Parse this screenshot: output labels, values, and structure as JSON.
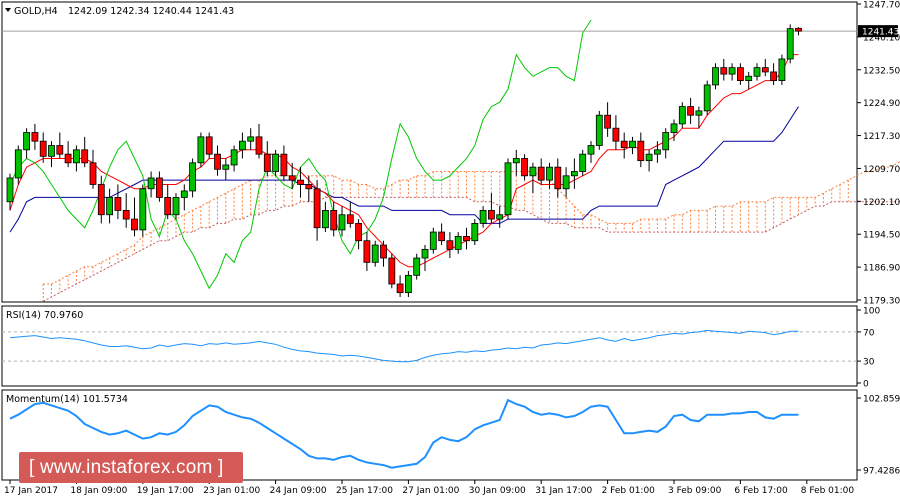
{
  "main_header": {
    "symbol": "GOLD,H4",
    "ohlc": "1242.09 1242.34 1240.44 1241.43"
  },
  "rsi_header": "RSI(14) 70.9760",
  "momentum_header": "Momentum(14) 101.5734",
  "watermark": "[ www.instaforex.com ]",
  "colors": {
    "bull": "#00c000",
    "bear": "#ff0000",
    "tenkan": "#ff0000",
    "kijun": "#0000a0",
    "chikou": "#00c800",
    "cloud": "#ff8040",
    "cloud_b": "#c06060",
    "indicator": "#1e90ff",
    "banner": "#d35a56"
  },
  "chart_data": [
    {
      "type": "candlestick",
      "price_axis": {
        "ticks": [
          "1247.70",
          "1240.10",
          "1232.50",
          "1224.90",
          "1217.30",
          "1209.70",
          "1202.10",
          "1194.50",
          "1186.90",
          "1179.30"
        ],
        "range": [
          1179.3,
          1247.7
        ],
        "current_price_label": "1241.43",
        "current_price": 1241.43
      },
      "time_axis": {
        "labels": [
          "17 Jan 2017",
          "18 Jan 09:00",
          "19 Jan 17:00",
          "23 Jan 01:00",
          "24 Jan 09:00",
          "25 Jan 17:00",
          "27 Jan 01:00",
          "30 Jan 09:00",
          "31 Jan 17:00",
          "2 Feb 01:00",
          "3 Feb 09:00",
          "6 Feb 17:00",
          "8 Feb 01:00"
        ],
        "label_bar_index": [
          0,
          8,
          16,
          24,
          32,
          40,
          48,
          56,
          64,
          72,
          80,
          88,
          96
        ]
      },
      "candles": [
        [
          1202,
          1208.5,
          1200,
          1207.5
        ],
        [
          1207.5,
          1215,
          1206,
          1214
        ],
        [
          1214,
          1219,
          1212,
          1218
        ],
        [
          1218,
          1220,
          1214,
          1216
        ],
        [
          1216,
          1218,
          1211,
          1212.5
        ],
        [
          1212.5,
          1216,
          1210,
          1215
        ],
        [
          1215,
          1218,
          1212,
          1213
        ],
        [
          1213,
          1216,
          1210,
          1211
        ],
        [
          1211,
          1215,
          1209,
          1214
        ],
        [
          1214,
          1217,
          1210,
          1211
        ],
        [
          1211,
          1214,
          1205,
          1206
        ],
        [
          1206,
          1208,
          1197,
          1199
        ],
        [
          1199,
          1205,
          1197,
          1203
        ],
        [
          1203,
          1206,
          1198,
          1200
        ],
        [
          1200,
          1204,
          1196,
          1198
        ],
        [
          1198,
          1203,
          1194,
          1195.5
        ],
        [
          1195.5,
          1206,
          1194,
          1205
        ],
        [
          1205,
          1209,
          1203,
          1207.5
        ],
        [
          1207.5,
          1209,
          1202,
          1203
        ],
        [
          1203,
          1206,
          1198,
          1199
        ],
        [
          1199,
          1204,
          1198,
          1203
        ],
        [
          1203,
          1206,
          1200,
          1204.5
        ],
        [
          1204.5,
          1212,
          1203,
          1211
        ],
        [
          1211,
          1218,
          1210,
          1217
        ],
        [
          1217,
          1218,
          1212,
          1213
        ],
        [
          1213,
          1215,
          1208,
          1209.5
        ],
        [
          1209.5,
          1212,
          1207,
          1210.5
        ],
        [
          1210.5,
          1215,
          1209,
          1214
        ],
        [
          1214,
          1218,
          1212,
          1216
        ],
        [
          1216,
          1219,
          1214,
          1217
        ],
        [
          1217,
          1220,
          1212,
          1213
        ],
        [
          1213,
          1216,
          1208,
          1209
        ],
        [
          1209,
          1214,
          1208,
          1213
        ],
        [
          1213,
          1215,
          1207,
          1208
        ],
        [
          1208,
          1211,
          1205,
          1207
        ],
        [
          1207,
          1210,
          1203,
          1206
        ],
        [
          1206,
          1208,
          1202,
          1205
        ],
        [
          1205,
          1207,
          1193,
          1196
        ],
        [
          1196,
          1202,
          1195,
          1200
        ],
        [
          1200,
          1202,
          1194,
          1195.5
        ],
        [
          1195.5,
          1201,
          1194,
          1199
        ],
        [
          1199,
          1202,
          1196,
          1197
        ],
        [
          1197,
          1198,
          1191,
          1193
        ],
        [
          1193,
          1195,
          1186,
          1188
        ],
        [
          1188,
          1193,
          1187,
          1192
        ],
        [
          1192,
          1193,
          1187,
          1189
        ],
        [
          1189,
          1190,
          1182,
          1183
        ],
        [
          1183,
          1185,
          1180,
          1181
        ],
        [
          1181,
          1186,
          1180,
          1185
        ],
        [
          1185,
          1190,
          1184,
          1189
        ],
        [
          1189,
          1192,
          1186,
          1191
        ],
        [
          1191,
          1196,
          1190,
          1195
        ],
        [
          1195,
          1197,
          1192,
          1193
        ],
        [
          1193,
          1195,
          1189,
          1191
        ],
        [
          1191,
          1195,
          1190,
          1194
        ],
        [
          1194,
          1196,
          1191,
          1193
        ],
        [
          1193,
          1198,
          1192,
          1197
        ],
        [
          1197,
          1201,
          1196,
          1200
        ],
        [
          1200,
          1204,
          1197,
          1198
        ],
        [
          1198,
          1201,
          1196,
          1199
        ],
        [
          1199,
          1212,
          1198,
          1211
        ],
        [
          1211,
          1214,
          1208,
          1212
        ],
        [
          1212,
          1213,
          1207,
          1208
        ],
        [
          1208,
          1211,
          1204,
          1210
        ],
        [
          1210,
          1212,
          1206,
          1207
        ],
        [
          1207,
          1211,
          1205,
          1210
        ],
        [
          1210,
          1212,
          1203,
          1205
        ],
        [
          1205,
          1210,
          1203,
          1208
        ],
        [
          1208,
          1212,
          1205,
          1209
        ],
        [
          1209,
          1214,
          1208,
          1213
        ],
        [
          1213,
          1216,
          1211,
          1215
        ],
        [
          1215,
          1223,
          1214,
          1222
        ],
        [
          1222,
          1225,
          1217,
          1219
        ],
        [
          1219,
          1222,
          1214,
          1216
        ],
        [
          1216,
          1218,
          1212,
          1214.5
        ],
        [
          1214.5,
          1217,
          1213,
          1216
        ],
        [
          1216,
          1218,
          1210,
          1211.5
        ],
        [
          1211.5,
          1214,
          1209,
          1213
        ],
        [
          1213,
          1216,
          1211,
          1214
        ],
        [
          1214,
          1219,
          1212,
          1218
        ],
        [
          1218,
          1221,
          1216,
          1220
        ],
        [
          1220,
          1225,
          1219,
          1224
        ],
        [
          1224,
          1226,
          1220,
          1222
        ],
        [
          1222,
          1224,
          1219,
          1223
        ],
        [
          1223,
          1230,
          1222,
          1229
        ],
        [
          1229,
          1234,
          1228,
          1233
        ],
        [
          1233,
          1235,
          1230,
          1231.5
        ],
        [
          1231.5,
          1234,
          1230,
          1233
        ],
        [
          1233,
          1234,
          1229,
          1230
        ],
        [
          1230,
          1232,
          1228,
          1231
        ],
        [
          1231,
          1234,
          1230,
          1233
        ],
        [
          1233,
          1235,
          1231,
          1232
        ],
        [
          1232,
          1234,
          1229,
          1230
        ],
        [
          1230,
          1236,
          1229,
          1235
        ],
        [
          1235,
          1243,
          1234,
          1242
        ],
        [
          1242.09,
          1242.34,
          1240.44,
          1241.43
        ]
      ],
      "tenkan": [
        1200,
        1206,
        1210,
        1211,
        1212,
        1212,
        1212,
        1212,
        1212,
        1212,
        1211,
        1209,
        1208,
        1207,
        1206,
        1205,
        1205,
        1206,
        1206,
        1206,
        1206,
        1207,
        1209,
        1210,
        1212,
        1212,
        1212,
        1213,
        1214,
        1214,
        1214,
        1213,
        1213,
        1212,
        1210,
        1209,
        1207,
        1205,
        1204,
        1202,
        1201,
        1200,
        1199,
        1196,
        1194,
        1192,
        1190,
        1188,
        1187,
        1187,
        1188,
        1189,
        1190,
        1191,
        1192,
        1193,
        1194,
        1195,
        1197,
        1198,
        1199,
        1205,
        1206,
        1207,
        1206,
        1206,
        1206,
        1206,
        1207,
        1208,
        1209,
        1212,
        1214,
        1214,
        1214,
        1215,
        1214,
        1214,
        1215,
        1216,
        1217,
        1219,
        1219,
        1219,
        1222,
        1224,
        1226,
        1227,
        1227,
        1228,
        1229,
        1230,
        1230,
        1232,
        1236,
        1236
      ],
      "kijun": [
        1195,
        1198,
        1202,
        1203,
        1203,
        1203,
        1203,
        1203,
        1203,
        1203,
        1203,
        1203,
        1203,
        1204,
        1205,
        1206,
        1207,
        1207,
        1207,
        1207,
        1207,
        1207,
        1207,
        1207,
        1207,
        1207,
        1207,
        1207,
        1207,
        1207,
        1207,
        1207,
        1207,
        1207,
        1207,
        1206,
        1206,
        1205,
        1204,
        1203,
        1203,
        1202,
        1201,
        1201,
        1201,
        1201,
        1200,
        1200,
        1200,
        1200,
        1200,
        1200,
        1200,
        1199,
        1199,
        1199,
        1199,
        1197,
        1197,
        1197,
        1198,
        1198,
        1198,
        1198,
        1198,
        1198,
        1198,
        1198,
        1198,
        1198,
        1200,
        1201,
        1201,
        1201,
        1201,
        1201,
        1201,
        1201,
        1201,
        1206,
        1207,
        1208,
        1209,
        1210,
        1212,
        1214,
        1216,
        1216,
        1216,
        1216,
        1216,
        1216,
        1216,
        1218,
        1221,
        1224
      ],
      "chikou": [
        1206,
        1210,
        1212,
        1211,
        1209,
        1206,
        1203,
        1200,
        1198,
        1196,
        1200,
        1205,
        1210,
        1214,
        1216,
        1212,
        1208,
        1198,
        1194,
        1200,
        1198,
        1193,
        1190,
        1186,
        1182,
        1185,
        1190,
        1188,
        1193,
        1195,
        1205,
        1210,
        1208,
        1206,
        1205,
        1210,
        1212,
        1209,
        1207,
        1199,
        1193,
        1190,
        1194,
        1195,
        1198,
        1203,
        1212,
        1220,
        1217,
        1212,
        1209,
        1207,
        1207,
        1208,
        1210,
        1212,
        1215,
        1221,
        1224,
        1225,
        1228,
        1236,
        1233,
        1231,
        1232,
        1233,
        1233,
        1231,
        1230,
        1241,
        1244
      ],
      "span_a": [
        1183,
        1183,
        1184,
        1185,
        1186,
        1187,
        1187,
        1188,
        1189,
        1190,
        1191,
        1192,
        1194,
        1195,
        1196,
        1197,
        1198,
        1199,
        1200,
        1201,
        1202,
        1203,
        1204,
        1205,
        1206,
        1207,
        1207,
        1208,
        1208,
        1208,
        1208,
        1208,
        1208,
        1208,
        1208,
        1208,
        1207,
        1207,
        1206,
        1206,
        1205,
        1205,
        1206,
        1207,
        1207,
        1208,
        1208,
        1209,
        1209,
        1209,
        1209,
        1209,
        1209,
        1209,
        1209,
        1209,
        1209,
        1209,
        1209,
        1209,
        1208,
        1207,
        1205,
        1203,
        1201,
        1199,
        1199,
        1198,
        1197,
        1197,
        1197,
        1197,
        1198,
        1198,
        1198,
        1198,
        1199,
        1199,
        1200,
        1200,
        1200,
        1201,
        1201,
        1201,
        1202,
        1202,
        1202,
        1202,
        1203,
        1203,
        1203,
        1203,
        1203,
        1203,
        1204,
        1205,
        1206,
        1207,
        1208,
        1209,
        1209,
        1210,
        1210,
        1211,
        1212
      ],
      "span_b": [
        1179,
        1180,
        1181,
        1182,
        1183,
        1184,
        1185,
        1186,
        1187,
        1188,
        1189,
        1190,
        1191,
        1192,
        1193,
        1193,
        1194,
        1195,
        1195,
        1196,
        1196,
        1197,
        1197,
        1198,
        1198,
        1199,
        1199,
        1200,
        1200,
        1201,
        1201,
        1202,
        1202,
        1202,
        1203,
        1203,
        1203,
        1203,
        1203,
        1203,
        1203,
        1203,
        1203,
        1203,
        1203,
        1203,
        1203,
        1203,
        1203,
        1203,
        1203,
        1203,
        1202,
        1202,
        1202,
        1201,
        1201,
        1200,
        1200,
        1199,
        1198,
        1197,
        1197,
        1197,
        1196,
        1196,
        1196,
        1196,
        1195,
        1195,
        1195,
        1195,
        1195,
        1195,
        1195,
        1195,
        1195,
        1195,
        1195,
        1195,
        1195,
        1195,
        1195,
        1195,
        1195,
        1195,
        1195,
        1195,
        1196,
        1197,
        1198,
        1199,
        1200,
        1201,
        1201,
        1202,
        1202,
        1202,
        1202,
        1202,
        1202,
        1202,
        1202,
        1202,
        1202
      ]
    },
    {
      "type": "line",
      "name": "RSI(14)",
      "y_ticks": [
        "100",
        "70",
        "30",
        "0"
      ],
      "levels": [
        70,
        30
      ],
      "ylim": [
        0,
        100
      ],
      "values": [
        62,
        63,
        64,
        65,
        63,
        61,
        62,
        61,
        60,
        58,
        55,
        52,
        50,
        50,
        51,
        49,
        47,
        48,
        52,
        50,
        52,
        54,
        53,
        51,
        54,
        53,
        55,
        53,
        54,
        55,
        57,
        55,
        53,
        49,
        46,
        44,
        43,
        41,
        40,
        39,
        37,
        38,
        37,
        35,
        33,
        31,
        30,
        29,
        29,
        31,
        35,
        38,
        40,
        41,
        43,
        42,
        44,
        43,
        45,
        46,
        48,
        47,
        49,
        48,
        52,
        53,
        55,
        54,
        56,
        58,
        60,
        62,
        59,
        57,
        61,
        58,
        60,
        62,
        65,
        66,
        68,
        67,
        69,
        70,
        72,
        71,
        70,
        69,
        68,
        71,
        70,
        69,
        66,
        68,
        71,
        71
      ]
    },
    {
      "type": "line",
      "name": "Momentum(14)",
      "y_ticks": [
        "102.8597",
        "97.4286"
      ],
      "ylim": [
        97.4286,
        102.8597
      ],
      "values": [
        101.3,
        101.6,
        102.0,
        102.4,
        102.5,
        102.3,
        102.1,
        101.9,
        101.5,
        100.9,
        100.6,
        100.3,
        100.1,
        100.2,
        100.4,
        100.1,
        99.8,
        99.9,
        100.2,
        100.1,
        100.3,
        100.8,
        101.5,
        101.9,
        102.3,
        102.2,
        101.8,
        101.6,
        101.4,
        101.3,
        101.0,
        100.6,
        100.2,
        99.8,
        99.4,
        99.0,
        98.5,
        98.3,
        98.3,
        98.2,
        98.4,
        98.5,
        98.2,
        98.0,
        97.9,
        97.8,
        97.6,
        97.7,
        97.8,
        97.9,
        98.4,
        99.5,
        99.9,
        99.7,
        99.6,
        99.9,
        100.5,
        100.8,
        101.0,
        101.2,
        102.7,
        102.4,
        102.2,
        101.8,
        101.6,
        101.7,
        101.6,
        101.4,
        101.5,
        101.8,
        102.2,
        102.3,
        102.2,
        101.2,
        100.2,
        100.2,
        100.3,
        100.4,
        100.3,
        100.7,
        101.5,
        101.6,
        101.2,
        101.1,
        101.6,
        101.6,
        101.6,
        101.7,
        101.7,
        101.8,
        101.8,
        101.4,
        101.3,
        101.6,
        101.6,
        101.6
      ]
    }
  ]
}
